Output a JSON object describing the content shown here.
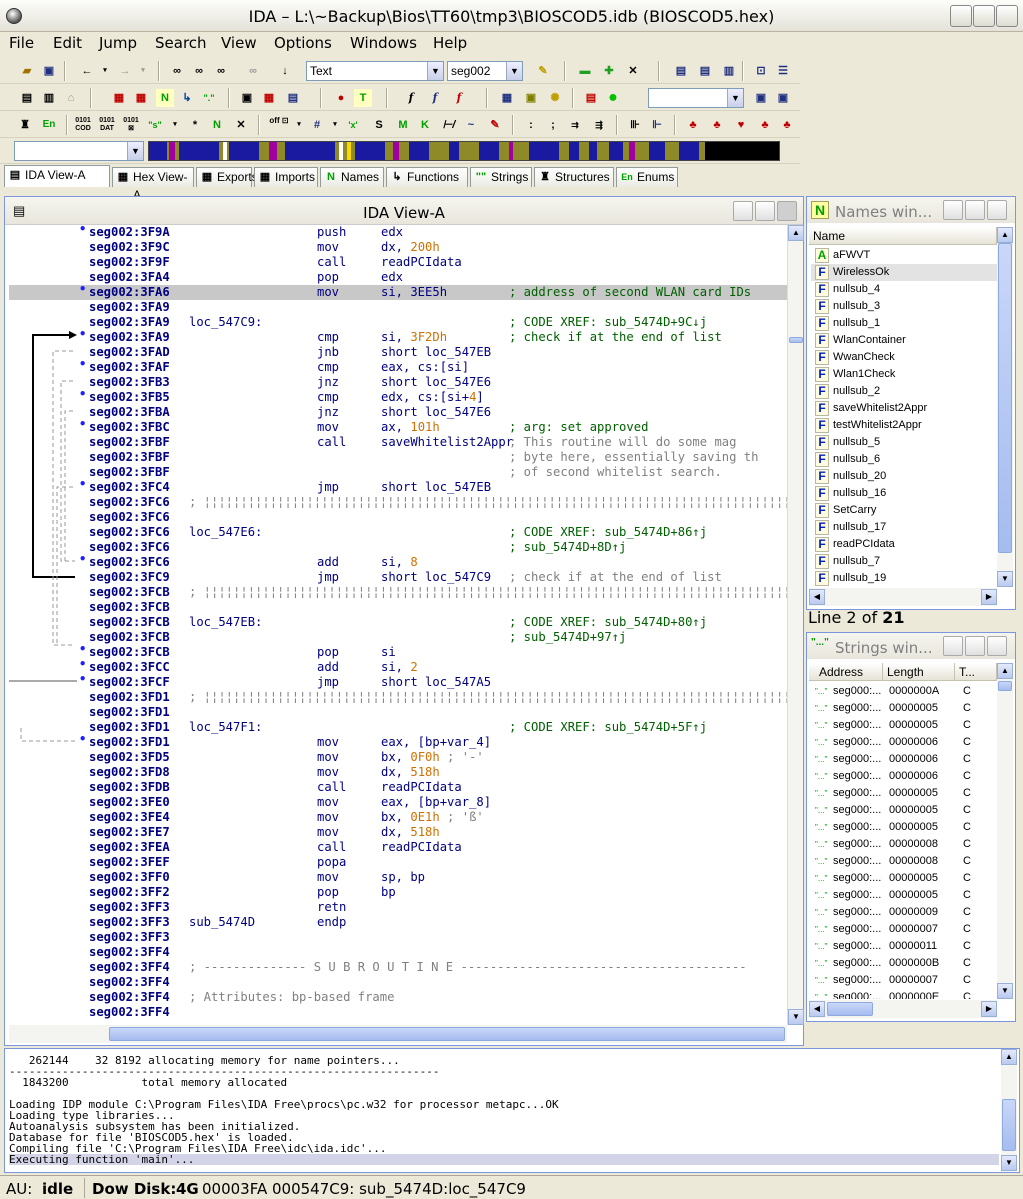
{
  "window": {
    "title": "IDA – L:\\~Backup\\Bios\\TT60\\tmp3\\BIOSCOD5.idb (BIOSCOD5.hex)"
  },
  "menu": [
    "File",
    "Edit",
    "Jump",
    "Search",
    "View",
    "Options",
    "Windows",
    "Help"
  ],
  "toolbar": {
    "text_combo": "Text",
    "segment_combo": "seg002"
  },
  "tabs": [
    {
      "label": "IDA View-A",
      "icon": "document-icon"
    },
    {
      "label": "Hex View-A",
      "icon": "hex-icon"
    },
    {
      "label": "Exports",
      "icon": "exports-icon"
    },
    {
      "label": "Imports",
      "icon": "imports-icon"
    },
    {
      "label": "Names",
      "icon": "names-icon"
    },
    {
      "label": "Functions",
      "icon": "functions-icon"
    },
    {
      "label": "Strings",
      "icon": "strings-icon"
    },
    {
      "label": "Structures",
      "icon": "structures-icon"
    },
    {
      "label": "Enums",
      "icon": "enums-icon"
    }
  ],
  "ida_view": {
    "title": "IDA View-A",
    "lines": [
      {
        "addr": "seg002:3F9A",
        "mn": "push",
        "op": "edx",
        "dot": true
      },
      {
        "addr": "seg002:3F9C",
        "mn": "mov",
        "op": "dx, ",
        "num": "200h"
      },
      {
        "addr": "seg002:3F9F",
        "mn": "call",
        "op": "readPCIdata"
      },
      {
        "addr": "seg002:3FA4",
        "mn": "pop",
        "op": "edx"
      },
      {
        "addr": "seg002:3FA6",
        "mn": "mov",
        "op": "si, 3EE5h",
        "cm": "; address of second WLAN card IDs",
        "hl": true,
        "dot": true
      },
      {
        "addr": "seg002:3FA9"
      },
      {
        "addr": "seg002:3FA9",
        "lbl": "loc_547C9:",
        "cm": "; CODE XREF: sub_5474D+9C↓j"
      },
      {
        "addr": "seg002:3FA9",
        "mn": "cmp",
        "op": "si, ",
        "num": "3F2Dh",
        "cm": "; check if at the end of list",
        "dot": true
      },
      {
        "addr": "seg002:3FAD",
        "mn": "jnb",
        "op": "short loc_547EB"
      },
      {
        "addr": "seg002:3FAF",
        "mn": "cmp",
        "op": "eax, cs:[si]",
        "dot": true
      },
      {
        "addr": "seg002:3FB3",
        "mn": "jnz",
        "op": "short loc_547E6"
      },
      {
        "addr": "seg002:3FB5",
        "mn": "cmp",
        "op": "edx, cs:[si+",
        "num": "4",
        "op2": "]",
        "dot": true
      },
      {
        "addr": "seg002:3FBA",
        "mn": "jnz",
        "op": "short loc_547E6"
      },
      {
        "addr": "seg002:3FBC",
        "mn": "mov",
        "op": "ax, ",
        "num": "101h",
        "cm": "; arg: set approved",
        "dot": true
      },
      {
        "addr": "seg002:3FBF",
        "mn": "call",
        "op": "saveWhitelist2Appr",
        "cg": "; This routine will do some mag"
      },
      {
        "addr": "seg002:3FBF",
        "cg": "; byte here, essentially saving th"
      },
      {
        "addr": "seg002:3FBF",
        "cg": "; of second whitelist search."
      },
      {
        "addr": "seg002:3FC4",
        "mn": "jmp",
        "op": "short loc_547EB",
        "dot": true
      },
      {
        "addr": "seg002:3FC6",
        "sep": "; ¦¦¦¦¦¦¦¦¦¦¦¦¦¦¦¦¦¦¦¦¦¦¦¦¦¦¦¦¦¦¦¦¦¦¦¦¦¦¦¦¦¦¦¦¦¦¦¦¦¦¦¦¦¦¦¦¦¦¦¦¦¦¦¦¦¦¦¦¦¦¦¦¦¦¦¦¦¦¦¦¦¦¦¦¦¦¦¦¦¦¦¦¦¦¦¦¦¦¦"
      },
      {
        "addr": "seg002:3FC6"
      },
      {
        "addr": "seg002:3FC6",
        "lbl": "loc_547E6:",
        "cm": "; CODE XREF: sub_5474D+86↑j"
      },
      {
        "addr": "seg002:3FC6",
        "cm": "; sub_5474D+8D↑j"
      },
      {
        "addr": "seg002:3FC6",
        "mn": "add",
        "op": "si, ",
        "num": "8",
        "dot": true
      },
      {
        "addr": "seg002:3FC9",
        "mn": "jmp",
        "op": "short loc_547C9",
        "cg": "; check if at the end of list"
      },
      {
        "addr": "seg002:3FCB",
        "sep": "; ¦¦¦¦¦¦¦¦¦¦¦¦¦¦¦¦¦¦¦¦¦¦¦¦¦¦¦¦¦¦¦¦¦¦¦¦¦¦¦¦¦¦¦¦¦¦¦¦¦¦¦¦¦¦¦¦¦¦¦¦¦¦¦¦¦¦¦¦¦¦¦¦¦¦¦¦¦¦¦¦¦¦¦¦¦¦¦¦¦¦¦¦¦¦¦¦¦¦¦"
      },
      {
        "addr": "seg002:3FCB"
      },
      {
        "addr": "seg002:3FCB",
        "lbl": "loc_547EB:",
        "cm": "; CODE XREF: sub_5474D+80↑j"
      },
      {
        "addr": "seg002:3FCB",
        "cm": "; sub_5474D+97↑j"
      },
      {
        "addr": "seg002:3FCB",
        "mn": "pop",
        "op": "si",
        "dot": true
      },
      {
        "addr": "seg002:3FCC",
        "mn": "add",
        "op": "si, ",
        "num": "2",
        "dot": true
      },
      {
        "addr": "seg002:3FCF",
        "mn": "jmp",
        "op": "short loc_547A5",
        "dot": true
      },
      {
        "addr": "seg002:3FD1",
        "sep": "; ¦¦¦¦¦¦¦¦¦¦¦¦¦¦¦¦¦¦¦¦¦¦¦¦¦¦¦¦¦¦¦¦¦¦¦¦¦¦¦¦¦¦¦¦¦¦¦¦¦¦¦¦¦¦¦¦¦¦¦¦¦¦¦¦¦¦¦¦¦¦¦¦¦¦¦¦¦¦¦¦¦¦¦¦¦¦¦¦¦¦¦¦¦¦¦¦¦¦¦"
      },
      {
        "addr": "seg002:3FD1"
      },
      {
        "addr": "seg002:3FD1",
        "lbl": "loc_547F1:",
        "cm": "; CODE XREF: sub_5474D+5F↑j"
      },
      {
        "addr": "seg002:3FD1",
        "mn": "mov",
        "op": "eax, [bp+var_4]",
        "dot": true
      },
      {
        "addr": "seg002:3FD5",
        "mn": "mov",
        "op": "bx, ",
        "num": "0F0h",
        "cg2": " ; '-'"
      },
      {
        "addr": "seg002:3FD8",
        "mn": "mov",
        "op": "dx, ",
        "num": "518h"
      },
      {
        "addr": "seg002:3FDB",
        "mn": "call",
        "op": "readPCIdata"
      },
      {
        "addr": "seg002:3FE0",
        "mn": "mov",
        "op": "eax, [bp+var_8]"
      },
      {
        "addr": "seg002:3FE4",
        "mn": "mov",
        "op": "bx, ",
        "num": "0E1h",
        "cg2": " ; 'ß'"
      },
      {
        "addr": "seg002:3FE7",
        "mn": "mov",
        "op": "dx, ",
        "num": "518h"
      },
      {
        "addr": "seg002:3FEA",
        "mn": "call",
        "op": "readPCIdata"
      },
      {
        "addr": "seg002:3FEF",
        "mn": "popa"
      },
      {
        "addr": "seg002:3FF0",
        "mn": "mov",
        "op": "sp, bp"
      },
      {
        "addr": "seg002:3FF2",
        "mn": "pop",
        "op": "bp"
      },
      {
        "addr": "seg002:3FF3",
        "mn": "retn"
      },
      {
        "addr": "seg002:3FF3",
        "lbl": "sub_5474D",
        "mn": "endp"
      },
      {
        "addr": "seg002:3FF3"
      },
      {
        "addr": "seg002:3FF4"
      },
      {
        "addr": "seg002:3FF4",
        "sep": "; -------------- S U B R O U T I N E ---------------------------------------"
      },
      {
        "addr": "seg002:3FF4"
      },
      {
        "addr": "seg002:3FF4",
        "sep": "; Attributes: bp-based frame"
      },
      {
        "addr": "seg002:3FF4"
      }
    ]
  },
  "names_window": {
    "title": "Names win...",
    "column": "Name",
    "items": [
      {
        "badge": "A",
        "name": "aFWVT"
      },
      {
        "badge": "F",
        "name": "WirelessOk",
        "selected": true
      },
      {
        "badge": "F",
        "name": "nullsub_4"
      },
      {
        "badge": "F",
        "name": "nullsub_3"
      },
      {
        "badge": "F",
        "name": "nullsub_1"
      },
      {
        "badge": "F",
        "name": "WlanContainer"
      },
      {
        "badge": "F",
        "name": "WwanCheck"
      },
      {
        "badge": "F",
        "name": "Wlan1Check"
      },
      {
        "badge": "F",
        "name": "nullsub_2"
      },
      {
        "badge": "F",
        "name": "saveWhitelist2Appr"
      },
      {
        "badge": "F",
        "name": "testWhitelist2Appr"
      },
      {
        "badge": "F",
        "name": "nullsub_5"
      },
      {
        "badge": "F",
        "name": "nullsub_6"
      },
      {
        "badge": "F",
        "name": "nullsub_20"
      },
      {
        "badge": "F",
        "name": "nullsub_16"
      },
      {
        "badge": "F",
        "name": "SetCarry"
      },
      {
        "badge": "F",
        "name": "nullsub_17"
      },
      {
        "badge": "F",
        "name": "readPCIdata"
      },
      {
        "badge": "F",
        "name": "nullsub_7"
      },
      {
        "badge": "F",
        "name": "nullsub_19"
      }
    ],
    "status_prefix": "Line 2 of ",
    "status_total": "21"
  },
  "strings_window": {
    "title": "Strings win...",
    "columns": [
      "Address",
      "Length",
      "T..."
    ],
    "rows": [
      [
        "seg000:...",
        "0000000A",
        "C"
      ],
      [
        "seg000:...",
        "00000005",
        "C"
      ],
      [
        "seg000:...",
        "00000005",
        "C"
      ],
      [
        "seg000:...",
        "00000006",
        "C"
      ],
      [
        "seg000:...",
        "00000006",
        "C"
      ],
      [
        "seg000:...",
        "00000006",
        "C"
      ],
      [
        "seg000:...",
        "00000005",
        "C"
      ],
      [
        "seg000:...",
        "00000005",
        "C"
      ],
      [
        "seg000:...",
        "00000005",
        "C"
      ],
      [
        "seg000:...",
        "00000008",
        "C"
      ],
      [
        "seg000:...",
        "00000008",
        "C"
      ],
      [
        "seg000:...",
        "00000005",
        "C"
      ],
      [
        "seg000:...",
        "00000005",
        "C"
      ],
      [
        "seg000:...",
        "00000009",
        "C"
      ],
      [
        "seg000:...",
        "00000007",
        "C"
      ],
      [
        "seg000:...",
        "00000011",
        "C"
      ],
      [
        "seg000:...",
        "0000000B",
        "C"
      ],
      [
        "seg000:...",
        "00000007",
        "C"
      ],
      [
        "seg000:...",
        "0000000E",
        "C"
      ]
    ]
  },
  "output_lines": [
    "   262144    32 8192 allocating memory for name pointers...",
    "-----------------------------------------------------------------",
    "  1843200           total memory allocated",
    "",
    "Loading IDP module C:\\Program Files\\IDA Free\\procs\\pc.w32 for processor metapc...OK",
    "Loading type libraries...",
    "Autoanalysis subsystem has been initialized.",
    "Database for file 'BIOSCOD5.hex' is loaded.",
    "Compiling file 'C:\\Program Files\\IDA Free\\idc\\ida.idc'...",
    "Executing function 'main'..."
  ],
  "status": {
    "au_label": "AU:",
    "au_state": "idle",
    "disk_label": "Dow Disk:",
    "disk_value": "4G",
    "position": "00003FA 000547C9: sub_5474D:loc_547C9"
  }
}
